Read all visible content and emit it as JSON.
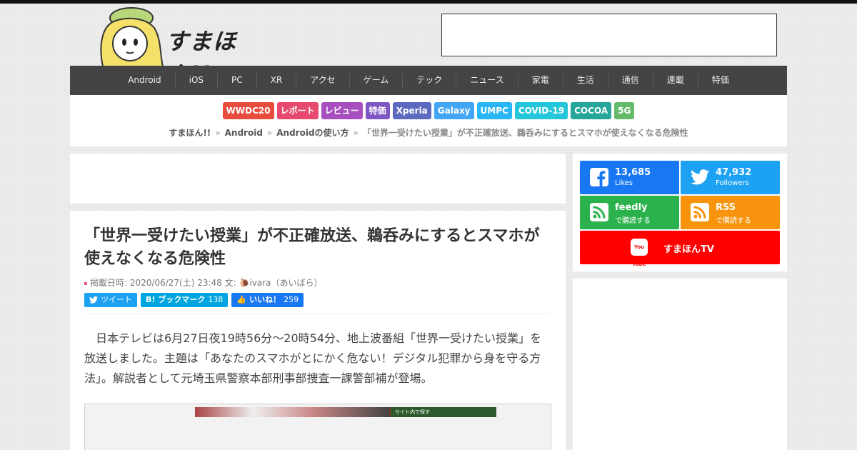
{
  "site": {
    "logo_text": "すまほん!!"
  },
  "nav": {
    "items": [
      "Android",
      "iOS",
      "PC",
      "XR",
      "アクセ",
      "ゲーム",
      "テック",
      "ニュース",
      "家電",
      "生活",
      "通信",
      "連載",
      "特価"
    ]
  },
  "tags": [
    {
      "label": "WWDC20",
      "color": "#e74c3c"
    },
    {
      "label": "レポート",
      "color": "#e84a6f"
    },
    {
      "label": "レビュー",
      "color": "#a84fbf"
    },
    {
      "label": "特価",
      "color": "#7e57c2"
    },
    {
      "label": "Xperia",
      "color": "#5c6bc0"
    },
    {
      "label": "Galaxy",
      "color": "#42a5f5"
    },
    {
      "label": "UMPC",
      "color": "#29b6f6"
    },
    {
      "label": "COVID-19",
      "color": "#26c6da"
    },
    {
      "label": "COCOA",
      "color": "#26a69a"
    },
    {
      "label": "5G",
      "color": "#66bb6a"
    }
  ],
  "breadcrumb": {
    "home": "すまほん!!",
    "cat": "Android",
    "sub": "Androidの使い方",
    "current": "「世界一受けたい授業」が不正確放送、鵜呑みにするとスマホが使えなくなる危険性",
    "separator": "»"
  },
  "article": {
    "title": "「世界一受けたい授業」が不正確放送、鵜呑みにするとスマホが使えなくなる危険性",
    "date_label": "掲載日時: 2020/06/27(土) 23:48",
    "author_label": "文:",
    "author": "ivara（あいばら）",
    "share": {
      "tweet": "ツイート",
      "hatena": "ブックマーク",
      "hatena_count": "138",
      "like": "いいね！",
      "like_count": "259"
    },
    "body": "日本テレビは6月27日夜19時56分～20時54分、地上波番組「世界一受けたい授業」を放送しました。主題は「あなたのスマホがとにかく危ない！デジタル犯罪から身を守る方法」。解説者として元埼玉県警察本部刑事部捜査一課警部補が登場。",
    "figure_caption": "サイト内で探す"
  },
  "sns": {
    "facebook": {
      "count": "13,685",
      "sub": "Likes",
      "color": "#1877f2"
    },
    "twitter": {
      "count": "47,932",
      "sub": "Followers",
      "color": "#1da1f2"
    },
    "feedly": {
      "count": "feedly",
      "sub": "で購読する",
      "color": "#2bb24c"
    },
    "rss": {
      "count": "RSS",
      "sub": "で購読する",
      "color": "#f7930d"
    },
    "youtube": {
      "label": "すまほんTV",
      "icon_text": "You Tube",
      "color": "#ff0000"
    }
  }
}
